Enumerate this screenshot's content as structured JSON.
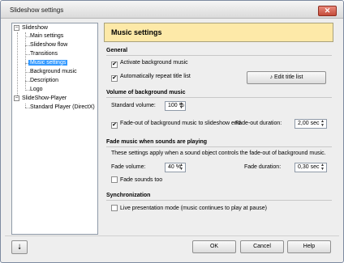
{
  "window": {
    "title": "Slideshow settings",
    "close_glyph": "✕"
  },
  "tree": {
    "items": [
      {
        "label": "Slideshow",
        "expander": "−"
      },
      {
        "label": "Main settings"
      },
      {
        "label": "Slideshow flow"
      },
      {
        "label": "Transitions"
      },
      {
        "label": "Music settings"
      },
      {
        "label": "Background music"
      },
      {
        "label": "Description"
      },
      {
        "label": "Logo"
      },
      {
        "label": "SlideShow-Player",
        "expander": "−"
      },
      {
        "label": "Standard Player (DirectX)"
      }
    ],
    "selected": "Music settings"
  },
  "header": {
    "title": "Music settings",
    "color": "#fde9a8"
  },
  "general": {
    "title": "General",
    "activate_label": "Activate background music",
    "activate_checked": true,
    "repeat_label": "Automatically repeat title list",
    "repeat_checked": true,
    "edit_button": "Edit title list"
  },
  "volume": {
    "title": "Volume of background music",
    "standard_label": "Standard volume:",
    "standard_value": "100 %",
    "fadeout_label": "Fade-out of background music to slideshow end",
    "fadeout_checked": true,
    "duration_label": "Fade-out duration:",
    "duration_value": "2,00 sec"
  },
  "fade": {
    "title": "Fade music when sounds are playing",
    "description": "These settings apply when a sound object controls the fade-out of background music.",
    "volume_label": "Fade volume:",
    "volume_value": "40 %",
    "duration_label": "Fade duration:",
    "duration_value": "0,30 sec",
    "sounds_too_label": "Fade sounds too",
    "sounds_too_checked": false
  },
  "sync": {
    "title": "Synchronization",
    "live_label": "Live presentation mode (music continues to play at pause)",
    "live_checked": false
  },
  "footer": {
    "arrow_glyph": "⭣",
    "ok": "OK",
    "cancel": "Cancel",
    "help": "Help"
  },
  "icons": {
    "check": "✔",
    "spin_up": "▲",
    "spin_down": "▼",
    "music_note": "♪"
  }
}
